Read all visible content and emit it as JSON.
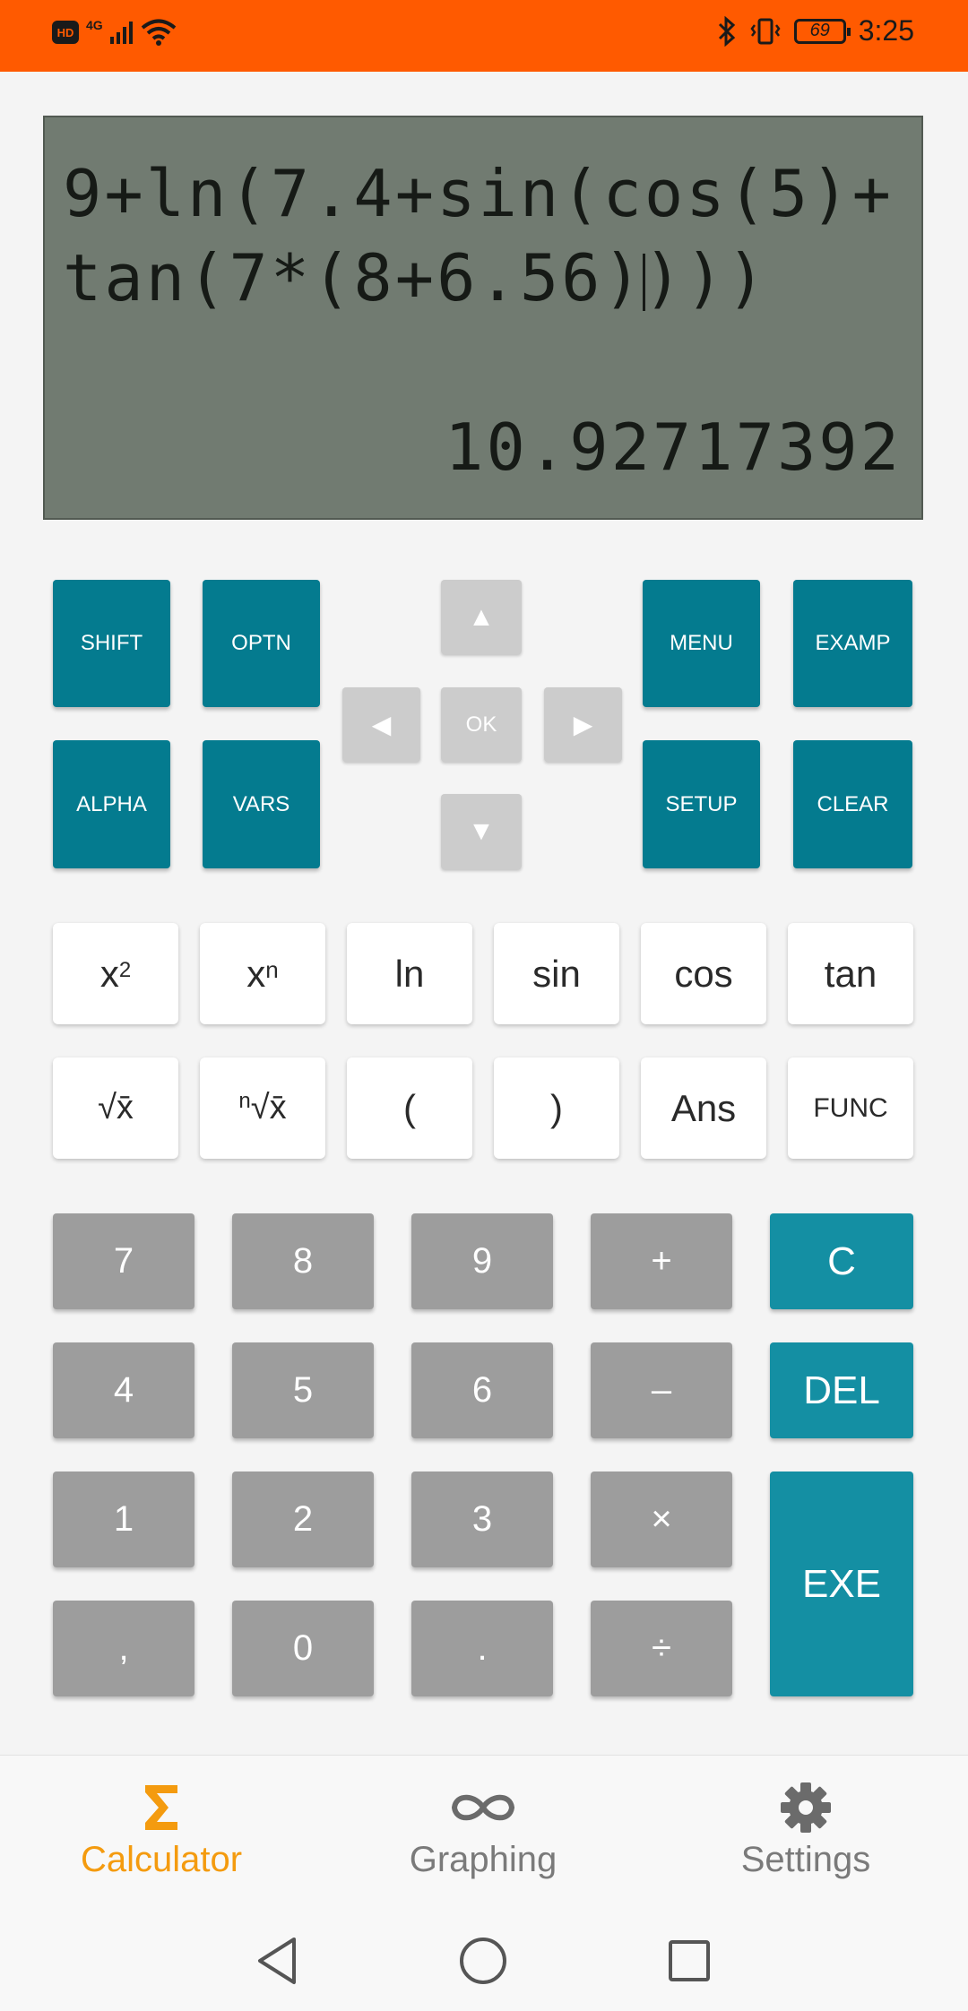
{
  "status_bar": {
    "network": "4G",
    "battery": "69",
    "time": "3:25",
    "hd_label": "HD"
  },
  "display": {
    "expression_before_cursor": "9+ln(7.4+sin(cos(5)+tan(7*(8+6.56)",
    "expression_after_cursor": ")))",
    "result": "10.92717392"
  },
  "function_keys": {
    "shift": "SHIFT",
    "optn": "OPTN",
    "alpha": "ALPHA",
    "vars": "VARS",
    "menu": "MENU",
    "examp": "EXAMP",
    "setup": "SETUP",
    "clear": "CLEAR"
  },
  "dpad": {
    "up": "▲",
    "left": "◀",
    "ok": "OK",
    "right": "▶",
    "down": "▼"
  },
  "sci_keys_row1": [
    {
      "base": "x",
      "sup": "2"
    },
    {
      "base": "x",
      "sup": "n"
    },
    {
      "label": "ln"
    },
    {
      "label": "sin"
    },
    {
      "label": "cos"
    },
    {
      "label": "tan"
    }
  ],
  "sci_keys_row2": {
    "sqrt": "√x̄",
    "nth_root_sup": "n",
    "nth_root": "√x̄",
    "open_paren": "(",
    "close_paren": ")",
    "ans": "Ans",
    "func": "FUNC"
  },
  "num_keys": {
    "rows": [
      [
        "7",
        "8",
        "9",
        "+"
      ],
      [
        "4",
        "5",
        "6",
        "–"
      ],
      [
        "1",
        "2",
        "3",
        "×"
      ],
      [
        ",",
        "0",
        ".",
        "÷"
      ]
    ],
    "c": "C",
    "del": "DEL",
    "exe": "EXE"
  },
  "bottom_nav": {
    "calculator": "Calculator",
    "graphing": "Graphing",
    "settings": "Settings"
  },
  "colors": {
    "status_bar": "#ff5a00",
    "lcd": "#717b71",
    "teal_key": "#047b8f",
    "exe_key": "#148fa3",
    "gray_key": "#9d9d9d",
    "active_nav": "#f49b0f"
  }
}
